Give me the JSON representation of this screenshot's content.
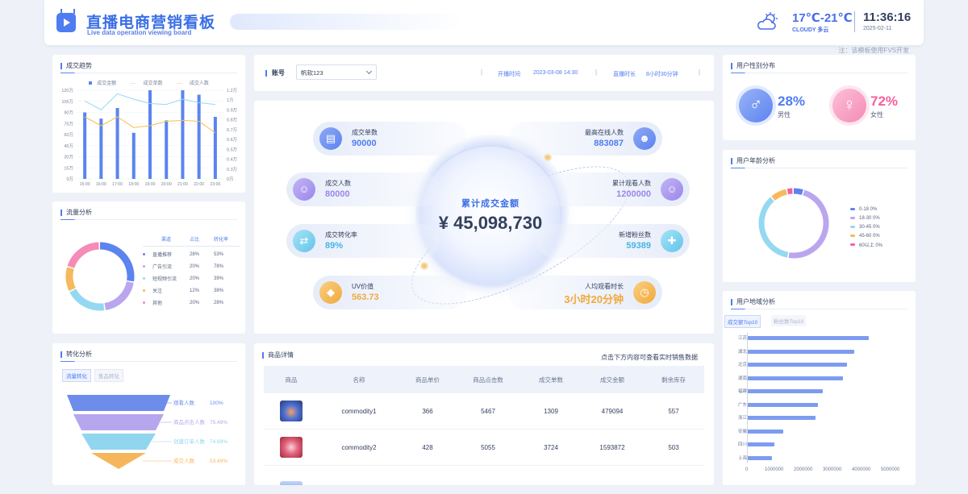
{
  "header": {
    "title": "直播电商营销看板",
    "subtitle": "Live data operation viewing board",
    "temp": "17℃-21℃",
    "weather": "CLOUDY 多云",
    "time": "11:36:16",
    "date": "2025-02-11",
    "note": "注：该模板使用FVS开发"
  },
  "trend": {
    "title": "成交趋势",
    "legend": [
      "成交金额",
      "成交单数",
      "成交人数"
    ],
    "hours": [
      "15:00",
      "16:00",
      "17:00",
      "18:00",
      "19:00",
      "20:00",
      "21:00",
      "22:00",
      "23:00"
    ],
    "y_left": [
      "120万",
      "105万",
      "90万",
      "75万",
      "60万",
      "45万",
      "30万",
      "15万",
      "0万"
    ],
    "y_right": [
      "1.2万",
      "1万",
      "0.9万",
      "0.8万",
      "0.7万",
      "0.6万",
      "0.5万",
      "0.4万",
      "0.3万",
      "0万"
    ],
    "bars": [
      75,
      68,
      80,
      52,
      100,
      66,
      100,
      95,
      70
    ],
    "line1": [
      88,
      78,
      96,
      90,
      85,
      84,
      90,
      86,
      84
    ],
    "line2": [
      70,
      60,
      70,
      58,
      60,
      65,
      66,
      65,
      52
    ]
  },
  "flow": {
    "title": "流量分析",
    "cols": [
      "渠道",
      "占比",
      "转化率"
    ],
    "rows": [
      {
        "name": "直播推荐",
        "share": "28%",
        "rate": "53%",
        "color": "#5b84f0"
      },
      {
        "name": "广告引流",
        "share": "20%",
        "rate": "78%",
        "color": "#b9a6ef"
      },
      {
        "name": "短视频引流",
        "share": "20%",
        "rate": "39%",
        "color": "#94d8f2"
      },
      {
        "name": "关注",
        "share": "12%",
        "rate": "38%",
        "color": "#f6b95e"
      },
      {
        "name": "其他",
        "share": "20%",
        "rate": "28%",
        "color": "#f58bb6"
      }
    ]
  },
  "conversion": {
    "title": "转化分析",
    "tabs": [
      "流量转化",
      "售品转化"
    ],
    "steps": [
      {
        "name": "观看人数",
        "pct": "100%",
        "color": "#6d8cec"
      },
      {
        "name": "商品点击人数",
        "pct": "75.49%",
        "color": "#b6a6ee"
      },
      {
        "name": "创建订单人数",
        "pct": "74.69%",
        "color": "#91d6ef"
      },
      {
        "name": "成交人数",
        "pct": "53.49%",
        "color": "#f6b75c"
      }
    ]
  },
  "account": {
    "label": "账号",
    "value": "帆软123",
    "start_label": "开播时间",
    "start": "2023-03-08 14:30",
    "dur_label": "直播时长",
    "dur": "8小时30分钟"
  },
  "metrics": {
    "total_label": "累计成交金额",
    "total": "¥ 45,098,730",
    "orders": {
      "label": "成交单数",
      "value": "90000"
    },
    "buyers": {
      "label": "成交人数",
      "value": "80000"
    },
    "conv": {
      "label": "成交转化率",
      "value": "89%"
    },
    "uv": {
      "label": "UV价值",
      "value": "563.73"
    },
    "peak": {
      "label": "最高在线人数",
      "value": "883087"
    },
    "viewers": {
      "label": "累计观看人数",
      "value": "1200000"
    },
    "fans": {
      "label": "新增粉丝数",
      "value": "59389"
    },
    "avgtime": {
      "label": "人均观看时长",
      "value": "3小时20分钟"
    }
  },
  "products": {
    "title": "商品详情",
    "hint": "点击下方内容可查看实时销售数据",
    "cols": [
      "商品",
      "名称",
      "商品单价",
      "商品点击数",
      "成交单数",
      "成交金额",
      "剩余库存"
    ],
    "rows": [
      {
        "name": "commodity1",
        "price": "366",
        "clicks": "5467",
        "orders": "1309",
        "amount": "479094",
        "stock": "557"
      },
      {
        "name": "commodity2",
        "price": "428",
        "clicks": "5055",
        "orders": "3724",
        "amount": "1593872",
        "stock": "503"
      }
    ]
  },
  "gender": {
    "title": "用户性别分布",
    "male_pct": "28%",
    "male": "男性",
    "female_pct": "72%",
    "female": "女性"
  },
  "age": {
    "title": "用户年龄分析",
    "items": [
      {
        "label": "0-18 0%",
        "color": "#5b84f0"
      },
      {
        "label": "18-30 0%",
        "color": "#b9a6ef"
      },
      {
        "label": "30-45 0%",
        "color": "#94d8f2"
      },
      {
        "label": "45-60 0%",
        "color": "#f6b95e"
      },
      {
        "label": "60以上 0%",
        "color": "#f5609a"
      }
    ]
  },
  "region": {
    "title": "用户地域分析",
    "tabs": [
      "成交额Top10",
      "粉丝数Top10"
    ],
    "rows": [
      {
        "name": "江苏",
        "value": 4200000
      },
      {
        "name": "湖北",
        "value": 3700000
      },
      {
        "name": "北京",
        "value": 3450000
      },
      {
        "name": "湖南",
        "value": 3300000
      },
      {
        "name": "福建",
        "value": 2600000
      },
      {
        "name": "广东",
        "value": 2450000
      },
      {
        "name": "浙江",
        "value": 2350000
      },
      {
        "name": "安徽",
        "value": 1250000
      },
      {
        "name": "四川",
        "value": 950000
      },
      {
        "name": "上海",
        "value": 850000
      }
    ],
    "ticks": [
      "0",
      "1000000",
      "2000000",
      "3000000",
      "4000000",
      "5000000"
    ]
  }
}
